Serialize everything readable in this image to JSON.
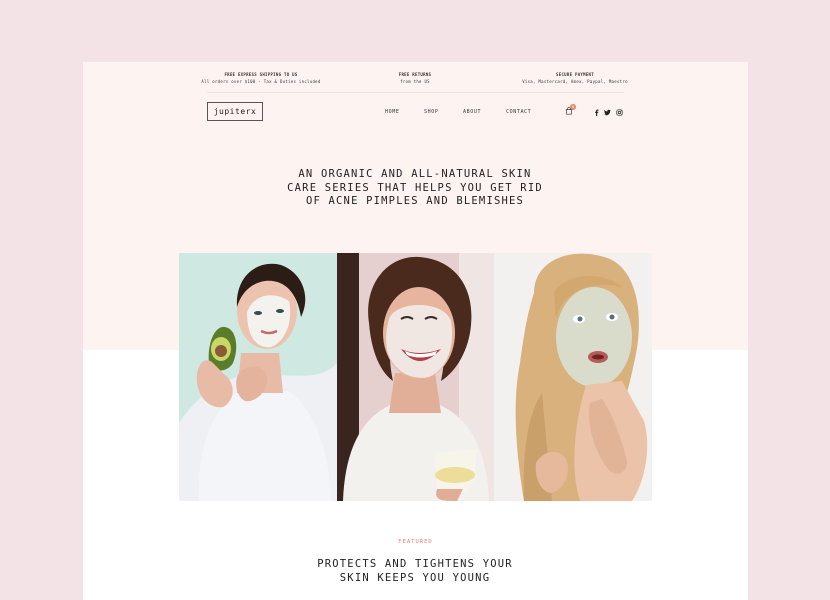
{
  "topbar": [
    {
      "title": "FREE EXPRESS SHIPPING TO US",
      "sub": "All orders over $100 - Tax & Duties included"
    },
    {
      "title": "FREE RETURNS",
      "sub": "from the US"
    },
    {
      "title": "SECURE PAYMENT",
      "sub": "Visa, Mastercard, Amex, Paypal, Maestro"
    }
  ],
  "logo": "jupiterx",
  "nav": [
    "HOME",
    "SHOP",
    "ABOUT",
    "CONTACT"
  ],
  "cart": {
    "count": "0",
    "icon": "cart-icon",
    "badge_color": "#e8836e"
  },
  "social": [
    "facebook-icon",
    "twitter-icon",
    "instagram-icon"
  ],
  "hero": {
    "line1": "AN ORGANIC AND ALL-NATURAL SKIN",
    "line2": "CARE SERIES THAT HELPS YOU GET RID",
    "line3": "OF ACNE PIMPLES AND BLEMISHES"
  },
  "featured_label": "FEATURED",
  "section": {
    "line1": "PROTECTS AND TIGHTENS YOUR",
    "line2": "SKIN KEEPS YOU YOUNG"
  },
  "colors": {
    "background": "#f3e3e7",
    "band": "#fdf3f1",
    "accent": "#e8836e"
  }
}
